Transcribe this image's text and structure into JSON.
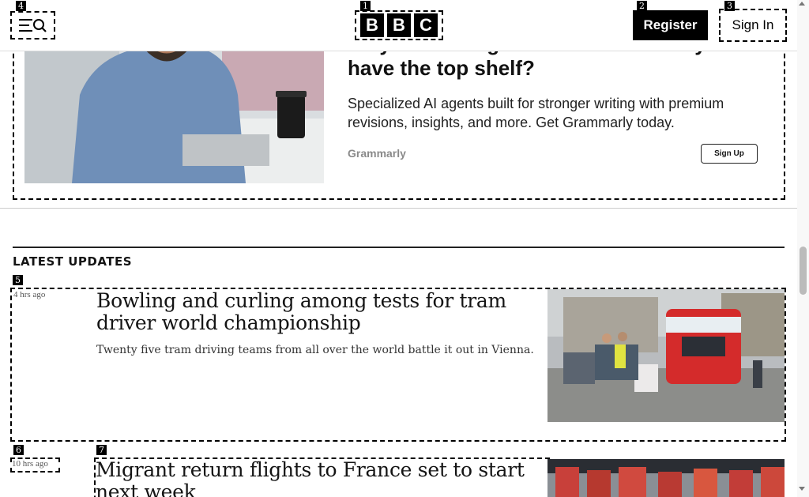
{
  "header": {
    "logo_letters": [
      "B",
      "B",
      "C"
    ],
    "register_label": "Register",
    "signin_label": "Sign In"
  },
  "ad": {
    "title_line1": "Why should a grammar checker only",
    "title_line2": "have the top shelf?",
    "description": "Specialized AI agents built for stronger writing with premium revisions, insights, and more. Get Grammarly today.",
    "brand": "Grammarly",
    "cta": "Sign Up"
  },
  "latest": {
    "section_title": "LATEST UPDATES",
    "stories": [
      {
        "time": "4 hrs ago",
        "headline": "Bowling and curling among tests for tram driver world championship",
        "summary": "Twenty five tram driving teams from all over the world battle it out in Vienna."
      },
      {
        "time": "10 hrs ago",
        "headline": "Migrant return flights to France set to start next week",
        "summary": ""
      }
    ]
  },
  "marks": [
    "1",
    "2",
    "3",
    "4",
    "5",
    "6",
    "7"
  ],
  "colors": {
    "brand": "#000000",
    "accent": "#141414"
  }
}
